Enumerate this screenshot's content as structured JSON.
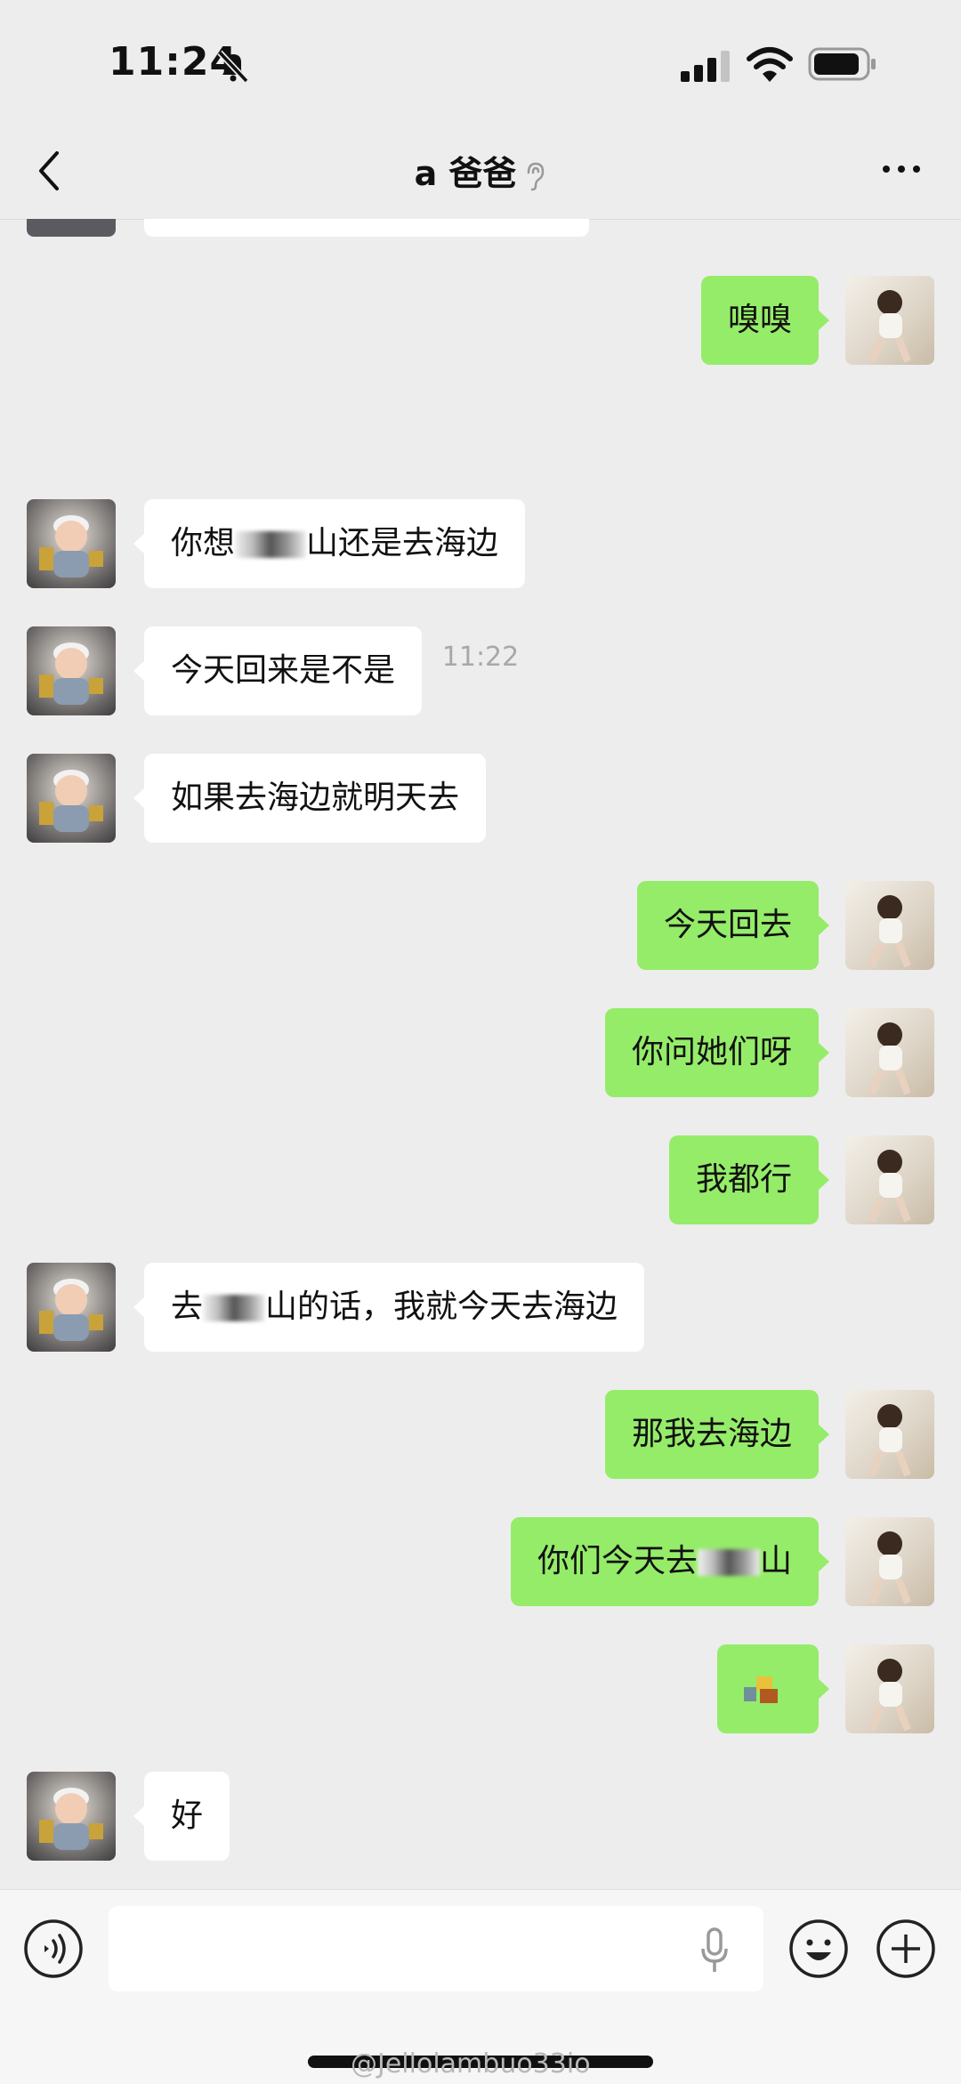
{
  "status_bar": {
    "time": "11:24"
  },
  "header": {
    "title": "a 爸爸"
  },
  "timestamp": "11:22",
  "messages": [
    {
      "text": "嗅嗅"
    },
    {
      "text_a": "你想",
      "text_b": "山还是去海边"
    },
    {
      "text": "今天回来是不是"
    },
    {
      "text": "如果去海边就明天去"
    },
    {
      "text": "今天回去"
    },
    {
      "text": "你问她们呀"
    },
    {
      "text": "我都行"
    },
    {
      "text_a": "去",
      "text_b": "山的话，我就今天去海边"
    },
    {
      "text": "那我去海边"
    },
    {
      "text_a": "你们今天去",
      "text_b": "山"
    },
    {
      "text": "好"
    }
  ],
  "input": {
    "placeholder": ""
  },
  "watermark": "@Jellolambuo33io",
  "colors": {
    "sent_bubble": "#95ec69",
    "received_bubble": "#ffffff",
    "background": "#ededed"
  },
  "icons": [
    "back-icon",
    "ear-icon",
    "more-icon",
    "voice-icon",
    "mic-icon",
    "emoji-icon",
    "plus-icon"
  ]
}
